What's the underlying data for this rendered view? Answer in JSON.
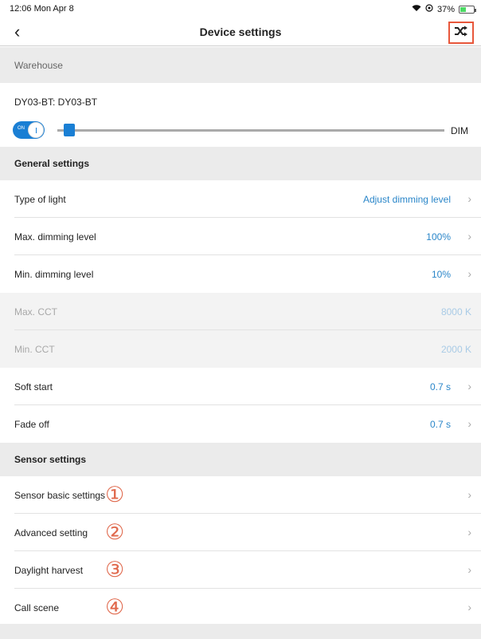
{
  "status": {
    "time": "12:06  Mon Apr 8",
    "battery": "37%"
  },
  "nav": {
    "title": "Device settings",
    "back_glyph": "‹",
    "action_icon": "shuffle-icon"
  },
  "group": {
    "label": "Warehouse"
  },
  "device": {
    "name": "DY03-BT: DY03-BT",
    "toggle_label": "ON",
    "toggle_on": true,
    "dim_level": 0.03,
    "dim_label": "DIM"
  },
  "general": {
    "header": "General settings",
    "rows": [
      {
        "label": "Type of light",
        "value": "Adjust dimming level"
      },
      {
        "label": "Max. dimming level",
        "value": "100%"
      },
      {
        "label": "Min. dimming level",
        "value": "10%"
      },
      {
        "label": "Max. CCT",
        "value": "8000 K"
      },
      {
        "label": "Min. CCT",
        "value": "2000 K"
      },
      {
        "label": "Soft start",
        "value": "0.7 s"
      },
      {
        "label": "Fade off",
        "value": "0.7 s"
      }
    ]
  },
  "sensor": {
    "header": "Sensor settings",
    "rows": [
      {
        "label": "Sensor basic settings",
        "marker": "①"
      },
      {
        "label": "Advanced setting",
        "marker": "②"
      },
      {
        "label": "Daylight harvest",
        "marker": "③"
      },
      {
        "label": "Call scene",
        "marker": "④"
      }
    ]
  },
  "colors": {
    "accent": "#1a7fd4",
    "value_text": "#2a86c9",
    "highlight_box": "#e8573b",
    "annotation": "#e06a4e"
  }
}
